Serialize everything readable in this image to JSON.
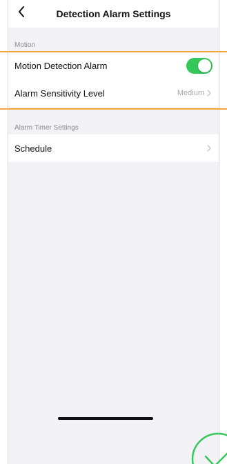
{
  "nav": {
    "title": "Detection Alarm Settings",
    "back_icon": "chevron-left-icon"
  },
  "motion_section": {
    "label": "Motion",
    "rows": [
      {
        "label": "Motion Detection Alarm",
        "toggle_on": true
      },
      {
        "label": "Alarm Sensitivity Level",
        "value": "Medium"
      }
    ]
  },
  "timer_section": {
    "label": "Alarm Timer Settings",
    "rows": [
      {
        "label": "Schedule"
      }
    ]
  },
  "colors": {
    "toggle_on": "#34c759",
    "highlight": "#f0a63c",
    "check_mark": "#34c759",
    "background": "#f2f2f7"
  },
  "icons": {
    "chevron_right": "chevron-right-icon",
    "check": "check-circle-icon"
  }
}
